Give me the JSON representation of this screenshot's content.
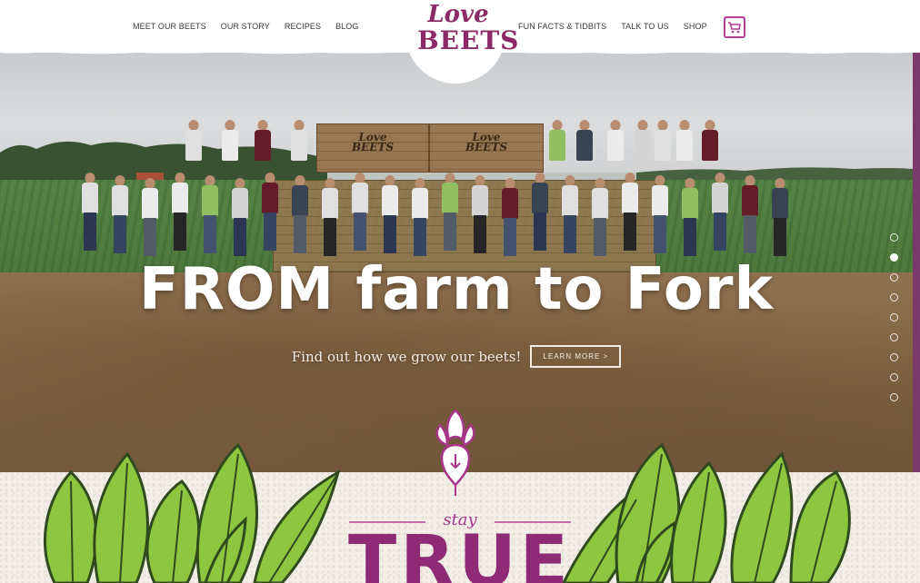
{
  "header": {
    "logo_line1": "Love",
    "logo_line2": "BEETS",
    "nav_left": [
      "MEET OUR BEETS",
      "OUR STORY",
      "RECIPES",
      "BLOG"
    ],
    "nav_right": [
      "FUN FACTS & TIDBITS",
      "TALK TO US",
      "SHOP"
    ],
    "cart_icon": "shopping-cart-icon"
  },
  "hero": {
    "crate_label_1": "Love\nBEETS",
    "crate_label_2": "Love\nBEETS",
    "title": "FROM farm to Fork",
    "subtitle": "Find out how we grow our beets!",
    "button_label": "LEARN MORE >",
    "slide_dots": 9,
    "active_dot": 2
  },
  "bottom": {
    "stay": "stay",
    "true": "TRUE"
  },
  "colors": {
    "brand_purple": "#8c2a68",
    "accent_magenta": "#b23d93",
    "leaf_green": "#8dc63f",
    "side_bar": "#7a3b6a"
  }
}
